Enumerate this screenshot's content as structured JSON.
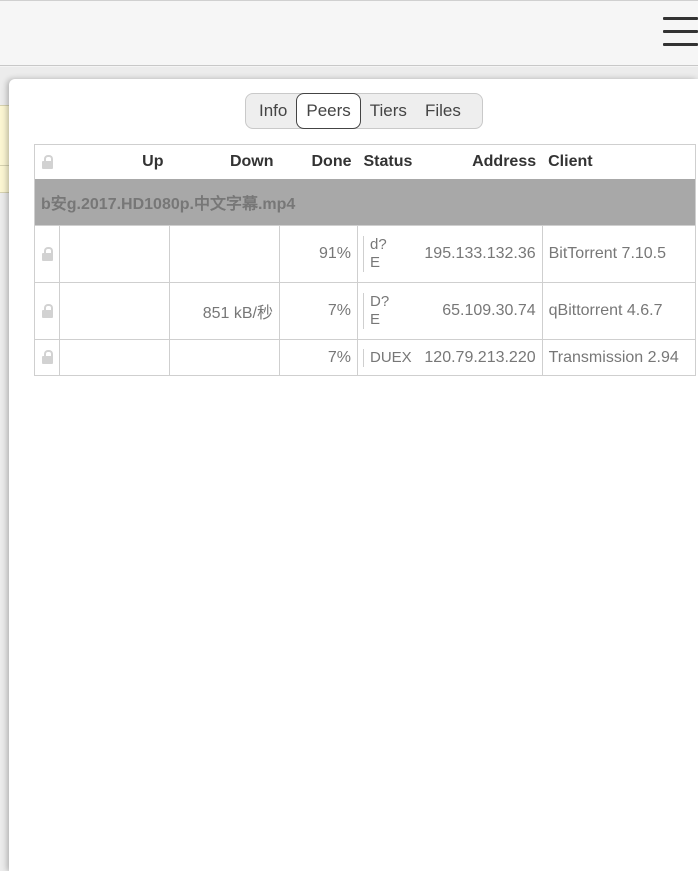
{
  "tabs": [
    {
      "label": "Info",
      "active": false
    },
    {
      "label": "Peers",
      "active": true
    },
    {
      "label": "Tiers",
      "active": false
    },
    {
      "label": "Files",
      "active": false
    }
  ],
  "columns": {
    "up": "Up",
    "down": "Down",
    "done": "Done",
    "status": "Status",
    "address": "Address",
    "client": "Client"
  },
  "torrent_name": "b安g.2017.HD1080p.中文字幕.mp4",
  "peers": [
    {
      "up": "",
      "down": "",
      "done": "91%",
      "status_line1": "d?",
      "status_line2": "E",
      "address": "195.133.132.36",
      "client": "BitTorrent 7.10.5"
    },
    {
      "up": "",
      "down": "851 kB/秒",
      "done": "7%",
      "status_line1": "D?",
      "status_line2": "E",
      "address": "65.109.30.74",
      "client": "qBittorrent 4.6.7"
    },
    {
      "up": "",
      "down": "",
      "done": "7%",
      "status_line1": "DUEX",
      "status_line2": "",
      "address": "120.79.213.220",
      "client": "Transmission 2.94"
    }
  ]
}
